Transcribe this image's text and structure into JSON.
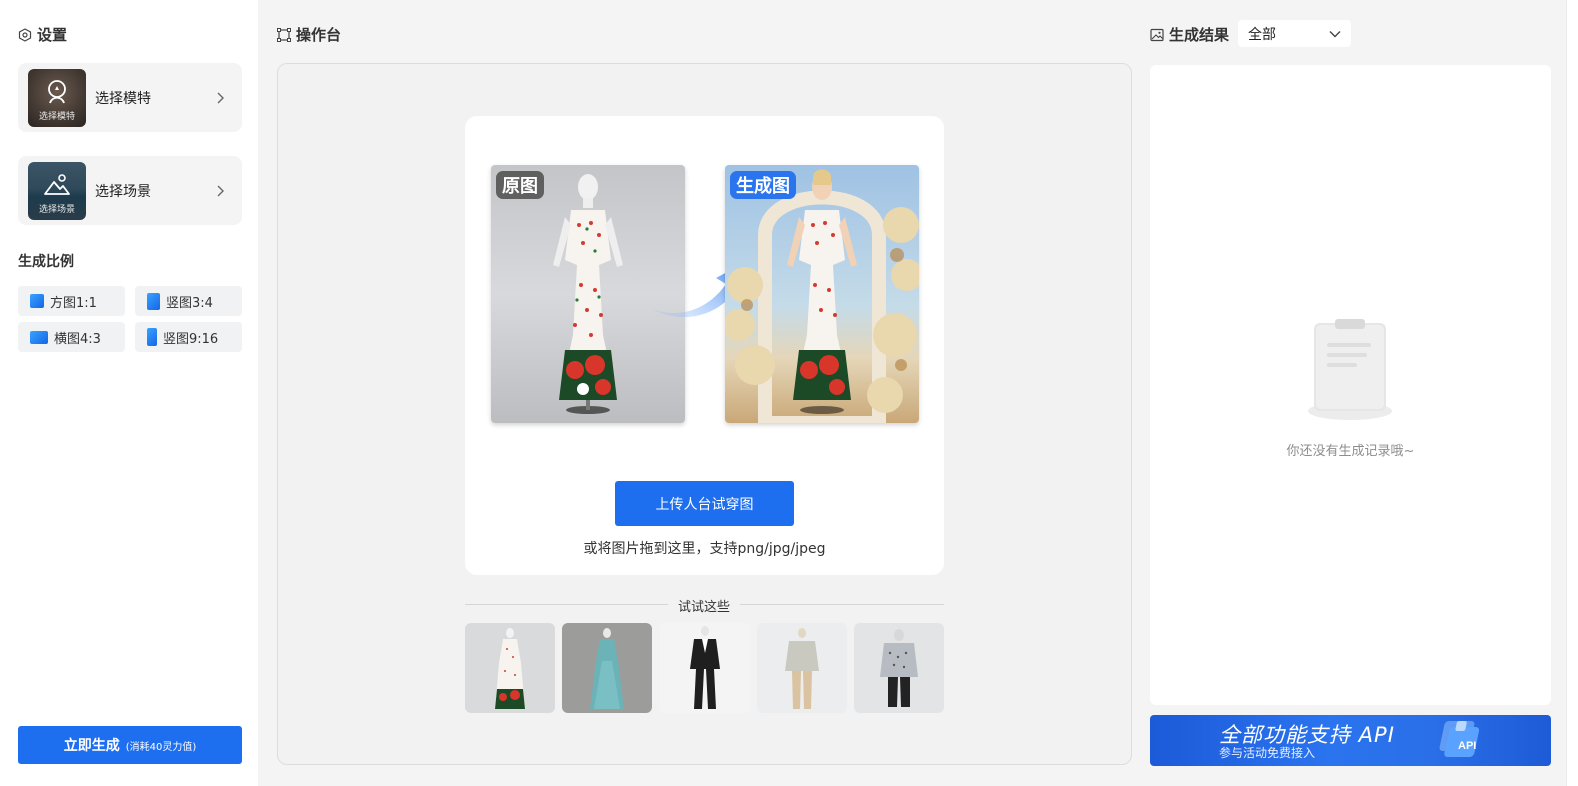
{
  "sidebar": {
    "settings_title": "设置",
    "model_card": {
      "label": "选择模特",
      "thumb_caption": "选择模特"
    },
    "scene_card": {
      "label": "选择场景",
      "thumb_caption": "选择场景"
    },
    "ratio_title": "生成比例",
    "ratios": [
      {
        "label": "方图1:1"
      },
      {
        "label": "竖图3:4"
      },
      {
        "label": "横图4:3"
      },
      {
        "label": "竖图9:16"
      }
    ],
    "generate_button": {
      "label": "立即生成",
      "cost": "(消耗40灵力值)"
    }
  },
  "workbench": {
    "title": "操作台",
    "original_tag": "原图",
    "generated_tag": "生成图",
    "upload_button": "上传人台试穿图",
    "drop_hint": "或将图片拖到这里，支持png/jpg/jpeg",
    "try_label": "试试这些",
    "samples": [
      "sample-1",
      "sample-2",
      "sample-3",
      "sample-4",
      "sample-5"
    ]
  },
  "results": {
    "title": "生成结果",
    "filter_value": "全部",
    "empty_text": "你还没有生成记录哦~",
    "api_banner": {
      "title": "全部功能支持 API",
      "subtitle": "参与活动免费接入",
      "badge": "API"
    }
  },
  "colors": {
    "accent": "#1e6ff0",
    "panel_bg": "#f2f2f2",
    "page_bg": "#f4f4f4"
  }
}
